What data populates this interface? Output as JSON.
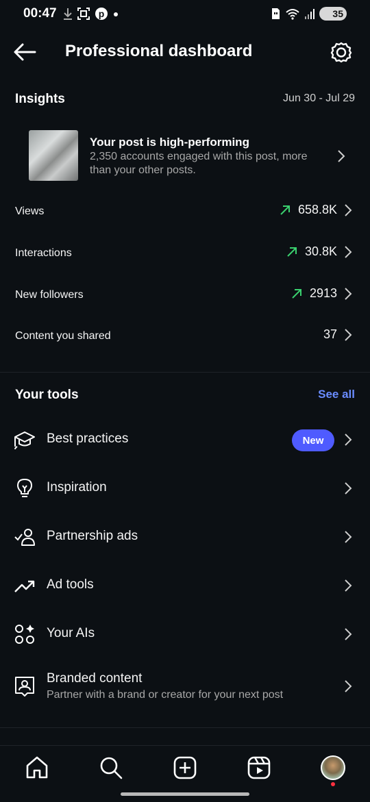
{
  "status_bar": {
    "time": "00:47",
    "battery": "35",
    "icons": [
      "download-icon",
      "screenshot-icon",
      "pinterest-icon",
      "dot-icon",
      "sim-icon",
      "wifi-icon",
      "signal-icon",
      "battery-icon"
    ]
  },
  "header": {
    "title": "Professional dashboard"
  },
  "insights": {
    "title": "Insights",
    "date_range": "Jun 30 - Jul 29",
    "card": {
      "title": "Your post is high-performing",
      "subtitle": "2,350 accounts engaged with this post, more than your other posts."
    },
    "metrics": [
      {
        "label": "Views",
        "value": "658.8K",
        "trend": "up"
      },
      {
        "label": "Interactions",
        "value": "30.8K",
        "trend": "up"
      },
      {
        "label": "New followers",
        "value": "2913",
        "trend": "up"
      },
      {
        "label": "Content you shared",
        "value": "37",
        "trend": "none"
      }
    ]
  },
  "tools": {
    "title": "Your tools",
    "see_all": "See all",
    "items": [
      {
        "label": "Best practices",
        "badge": "New",
        "icon": "graduation-cap-icon"
      },
      {
        "label": "Inspiration",
        "icon": "lightbulb-icon"
      },
      {
        "label": "Partnership ads",
        "icon": "partnership-icon"
      },
      {
        "label": "Ad tools",
        "icon": "trending-up-icon"
      },
      {
        "label": "Your AIs",
        "icon": "ai-sparkle-icon"
      },
      {
        "label": "Branded content",
        "subtitle": "Partner with a brand or creator for your next post",
        "icon": "branded-content-icon"
      }
    ]
  },
  "nav": {
    "items": [
      "home-icon",
      "search-icon",
      "create-icon",
      "reels-icon",
      "profile-avatar"
    ]
  },
  "colors": {
    "background": "#0c1014",
    "accent_link": "#6a8cff",
    "badge": "#4f5bff",
    "trend_up": "#3ad16f"
  }
}
